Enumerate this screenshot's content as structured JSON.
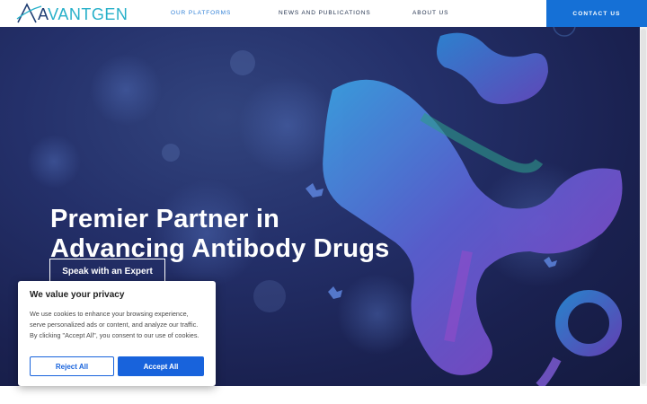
{
  "header": {
    "logo_text_a": "A",
    "logo_text_rest": "VANTGEN",
    "nav": [
      {
        "label": "OUR PLATFORMS",
        "active": true
      },
      {
        "label": "NEWS AND PUBLICATIONS",
        "active": false
      },
      {
        "label": "ABOUT US",
        "active": false
      }
    ],
    "contact_label": "CONTACT US"
  },
  "hero": {
    "headline_line1": "Premier Partner in",
    "headline_line2": "Advancing Antibody Drugs",
    "cta_label": "Speak with an Expert"
  },
  "cookie": {
    "title": "We value your privacy",
    "text": "We use cookies to enhance your browsing experience, serve personalized ads or content, and analyze our traffic. By clicking \"Accept All\", you consent to our use of cookies.",
    "reject_label": "Reject All",
    "accept_label": "Accept All"
  },
  "colors": {
    "brand_blue": "#1570d6",
    "logo_teal": "#27b0c9",
    "logo_navy": "#1f3e73",
    "cookie_blue": "#1863dc",
    "hero_bg": "#1a2150"
  },
  "icons": {
    "logo_mark": "avantgen-logo-icon",
    "antibody": "antibody-illustration"
  }
}
